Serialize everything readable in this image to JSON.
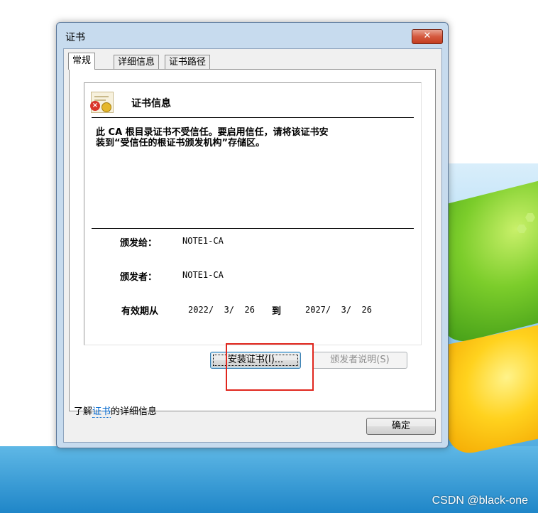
{
  "window": {
    "title": "证书",
    "close_label": "✕"
  },
  "tabs": [
    {
      "label": "常规",
      "active": true
    },
    {
      "label": "详细信息",
      "active": false
    },
    {
      "label": "证书路径",
      "active": false
    }
  ],
  "cert_info": {
    "icon": "certificate-untrusted-icon",
    "heading": "证书信息",
    "message_line1": "此 CA 根目录证书不受信任。要启用信任，请将该证书安",
    "message_line2": "装到“受信任的根证书颁发机构”存储区。",
    "issued_to_label": "颁发给：",
    "issued_to_value": "NOTE1-CA",
    "issued_by_label": "颁发者：",
    "issued_by_value": "NOTE1-CA",
    "validity_label": "有效期从",
    "valid_from": "2022/  3/  26",
    "to_label": "到",
    "valid_to": "2027/  3/  26"
  },
  "buttons": {
    "install_certificate": "安装证书(I)...",
    "issuer_statement": "颁发者说明(S)",
    "ok": "确定"
  },
  "learn_more": {
    "prefix": "了解",
    "link": "证书",
    "suffix": "的详细信息"
  },
  "watermark": "CSDN @black-one",
  "colors": {
    "highlight_box": "#e0261d",
    "close_button": "#c33d20",
    "link": "#0066cc"
  }
}
